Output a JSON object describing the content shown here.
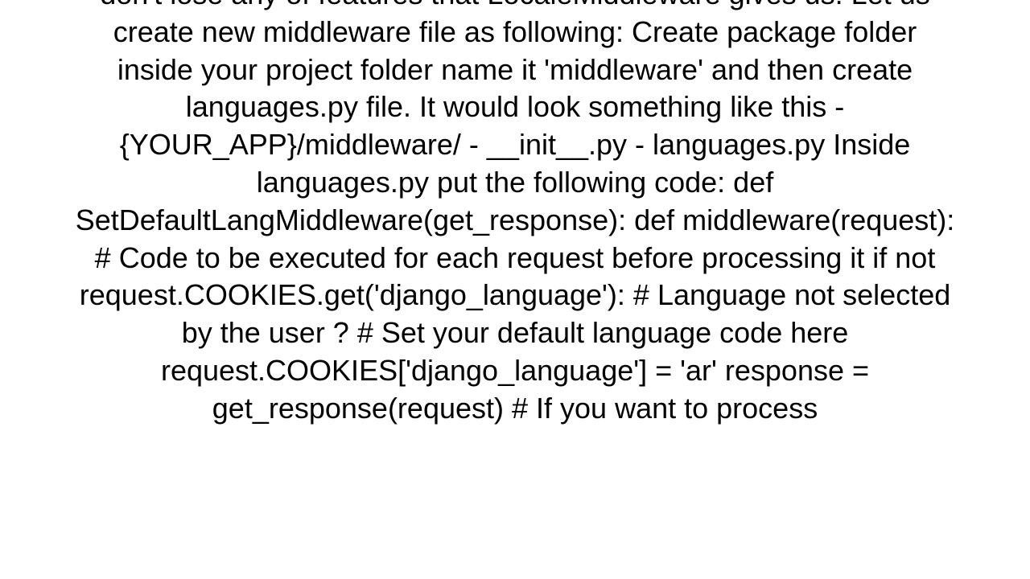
{
  "text": "don't lose any of features that LocaleMiddleware gives us.  Let us create new middleware file as following:   Create package folder inside your project folder name it 'middleware' and then create languages.py file. It would look something like this   - {YOUR_APP}/middleware/   - __init__.py   - languages.py    Inside languages.py put the following code:     def SetDefaultLangMiddleware(get_response):      def middleware(request):          # Code to be executed for each request before processing it                  if not request.COOKIES.get('django_language'): # Language not selected by the user ?              # Set your default language code here             request.COOKIES['django_language'] = 'ar'          response = get_response(request)          # If you want to process"
}
